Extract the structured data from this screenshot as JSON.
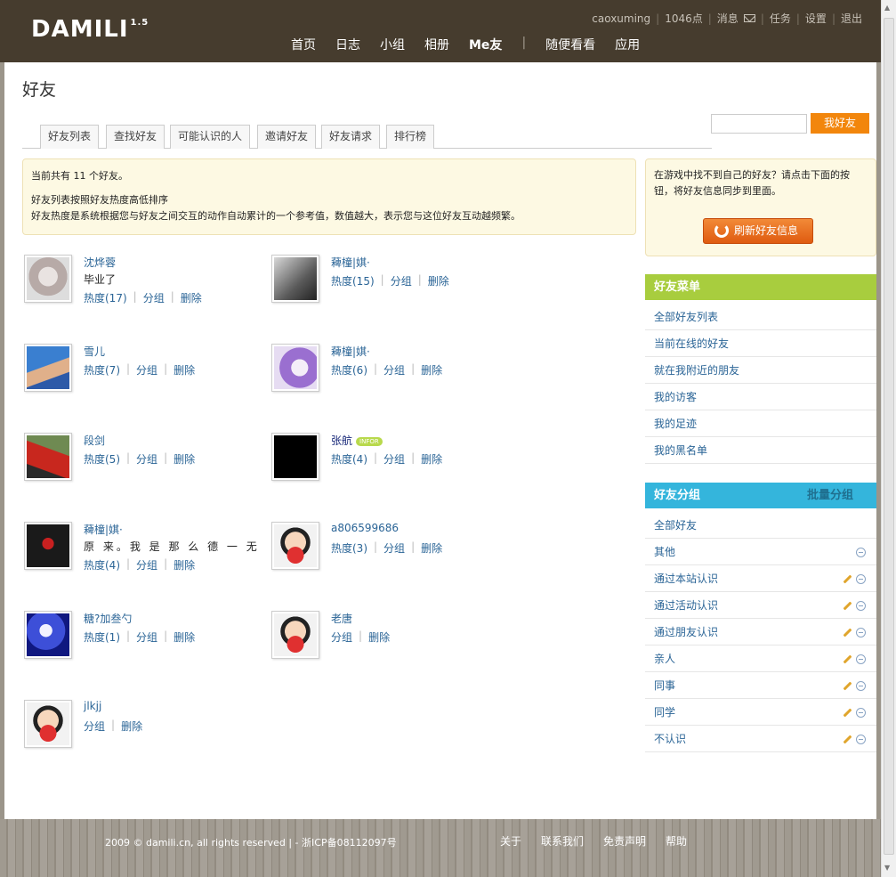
{
  "header": {
    "logo": "DAMILI",
    "logo_version": "1.5",
    "username": "caoxuming",
    "points": "1046点",
    "messages": "消息",
    "tasks": "任务",
    "settings": "设置",
    "logout": "退出",
    "nav": [
      "首页",
      "日志",
      "小组",
      "相册",
      "Me友",
      "随便看看",
      "应用"
    ]
  },
  "page": {
    "title": "好友",
    "tabs": [
      "好友列表",
      "查找好友",
      "可能认识的人",
      "邀请好友",
      "好友请求",
      "排行榜"
    ],
    "search_button": "我好友"
  },
  "notice": {
    "line1": "当前共有 11 个好友。",
    "line2": "好友列表按照好友热度高低排序",
    "line3": "好友热度是系统根据您与好友之间交互的动作自动累计的一个参考值，数值越大，表示您与这位好友互动越频繁。"
  },
  "friends": [
    {
      "name": "沈烨蓉",
      "status": "毕业了",
      "heat": "热度(17)",
      "group": "分组",
      "delete": "删除"
    },
    {
      "name": "薭橦|娸·",
      "status": "",
      "heat": "热度(15)",
      "group": "分组",
      "delete": "删除"
    },
    {
      "name": "雪儿",
      "status": "",
      "heat": "热度(7)",
      "group": "分组",
      "delete": "删除"
    },
    {
      "name": "薭橦|娸·",
      "status": "",
      "heat": "热度(6)",
      "group": "分组",
      "delete": "删除"
    },
    {
      "name": "段剑",
      "status": "",
      "heat": "热度(5)",
      "group": "分组",
      "delete": "删除"
    },
    {
      "name": "张航",
      "status": "",
      "badge": "INFOR",
      "heat": "热度(4)",
      "group": "分组",
      "delete": "删除"
    },
    {
      "name": "薭橦|娸·",
      "status": "原 来。我 是 那 么 德 一 无",
      "heat": "热度(4)",
      "group": "分组",
      "delete": "删除"
    },
    {
      "name": "a806599686",
      "status": "",
      "heat": "热度(3)",
      "group": "分组",
      "delete": "删除"
    },
    {
      "name": "糖?加叁勺",
      "status": "",
      "heat": "热度(1)",
      "group": "分组",
      "delete": "删除"
    },
    {
      "name": "老唐",
      "status": "",
      "heat": "",
      "group": "分组",
      "delete": "删除"
    },
    {
      "name": "jlkjj",
      "status": "",
      "heat": "",
      "group": "分组",
      "delete": "删除"
    }
  ],
  "sidebar": {
    "sync_text": "在游戏中找不到自己的好友？请点击下面的按钮，将好友信息同步到里面。",
    "sync_button": "刷新好友信息",
    "menu_title": "好友菜单",
    "menu_items": [
      "全部好友列表",
      "当前在线的好友",
      "就在我附近的朋友",
      "我的访客",
      "我的足迹",
      "我的黑名单"
    ],
    "groups_title": "好友分组",
    "groups_batch": "批量分组",
    "groups": [
      "全部好友",
      "其他",
      "通过本站认识",
      "通过活动认识",
      "通过朋友认识",
      "亲人",
      "同事",
      "同学",
      "不认识"
    ]
  },
  "footer": {
    "copyright": "2009 © damili.cn, all rights reserved | - 浙ICP备08112097号",
    "links": [
      "关于",
      "联系我们",
      "免责声明",
      "帮助"
    ]
  },
  "colors": {
    "header_bg": "#463c2e",
    "accent_orange": "#f2860c",
    "menu_green": "#a8cd3e",
    "group_blue": "#34b5dc",
    "link": "#2a6496"
  }
}
